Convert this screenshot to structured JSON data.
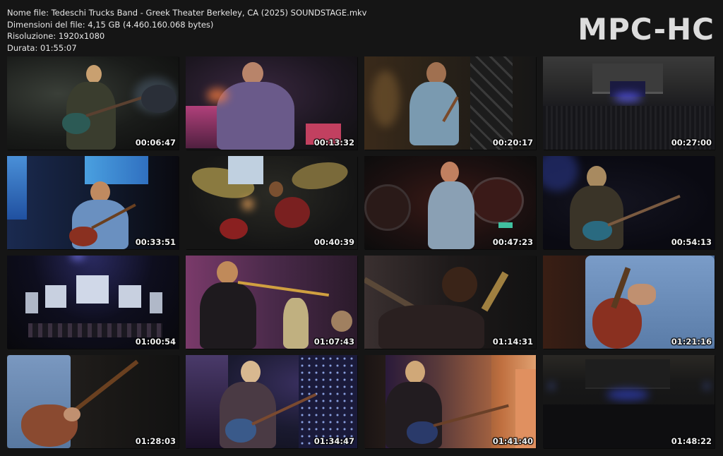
{
  "info": {
    "filename": "Nome file: Tedeschi Trucks Band -  Greek Theater Berkeley, CA (2025) SOUNDSTAGE.mkv",
    "filesize": "Dimensioni del file: 4,15 GB (4.460.160.068 bytes)",
    "resolution": "Risoluzione: 1920x1080",
    "duration": "Durata: 01:55:07"
  },
  "logo": "MPC-HC",
  "thumbnails": [
    {
      "time": "00:06:47",
      "scene": "singer-guitar-drums"
    },
    {
      "time": "00:13:32",
      "scene": "keyboardist"
    },
    {
      "time": "00:20:17",
      "scene": "guitarist-scaffold"
    },
    {
      "time": "00:27:00",
      "scene": "venue-wide"
    },
    {
      "time": "00:33:51",
      "scene": "guitarist-blue-screen"
    },
    {
      "time": "00:40:39",
      "scene": "drummer-cymbals"
    },
    {
      "time": "00:47:23",
      "scene": "guitarist-drums-red"
    },
    {
      "time": "00:54:13",
      "scene": "singer-guitar-dark"
    },
    {
      "time": "01:00:54",
      "scene": "stage-screens"
    },
    {
      "time": "01:07:43",
      "scene": "trombone-pink"
    },
    {
      "time": "01:14:31",
      "scene": "saxophone-closeup"
    },
    {
      "time": "01:21:16",
      "scene": "guitar-closeup"
    },
    {
      "time": "01:28:03",
      "scene": "guitar-hands"
    },
    {
      "time": "01:34:47",
      "scene": "singer-stars"
    },
    {
      "time": "01:41:40",
      "scene": "singer-orange"
    },
    {
      "time": "01:48:22",
      "scene": "venue-night"
    }
  ]
}
